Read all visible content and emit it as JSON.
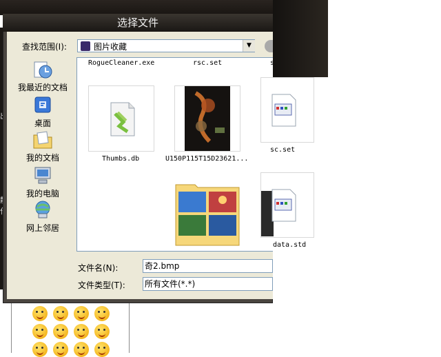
{
  "dialog": {
    "title": "选择文件",
    "look_in_label": "查找范围(I):",
    "look_in_value": "图片收藏",
    "filename_label": "文件名(N):",
    "filename_value": "奇2.bmp",
    "filetype_label": "文件类型(T):",
    "filetype_value": "所有文件(*.*)"
  },
  "places": [
    {
      "label": "我最近的文档",
      "icon": "recent-documents-icon"
    },
    {
      "label": "桌面",
      "icon": "desktop-icon"
    },
    {
      "label": "我的文档",
      "icon": "my-documents-icon"
    },
    {
      "label": "我的电脑",
      "icon": "my-computer-icon"
    },
    {
      "label": "网上邻居",
      "icon": "network-places-icon"
    }
  ],
  "files": {
    "top_row": [
      "RogueCleaner.exe",
      "rsc.set",
      "s"
    ],
    "items": [
      {
        "name": "Thumbs.db",
        "icon": "db-file-icon"
      },
      {
        "name": "U150P115T15D23621...",
        "icon": "image-thumbnail"
      },
      {
        "name": "",
        "icon": "folder-thumbnail-icon"
      }
    ]
  },
  "right_spill": [
    "sc.set",
    "data.std"
  ],
  "edge_chars": [
    "出",
    "静",
    "作"
  ]
}
